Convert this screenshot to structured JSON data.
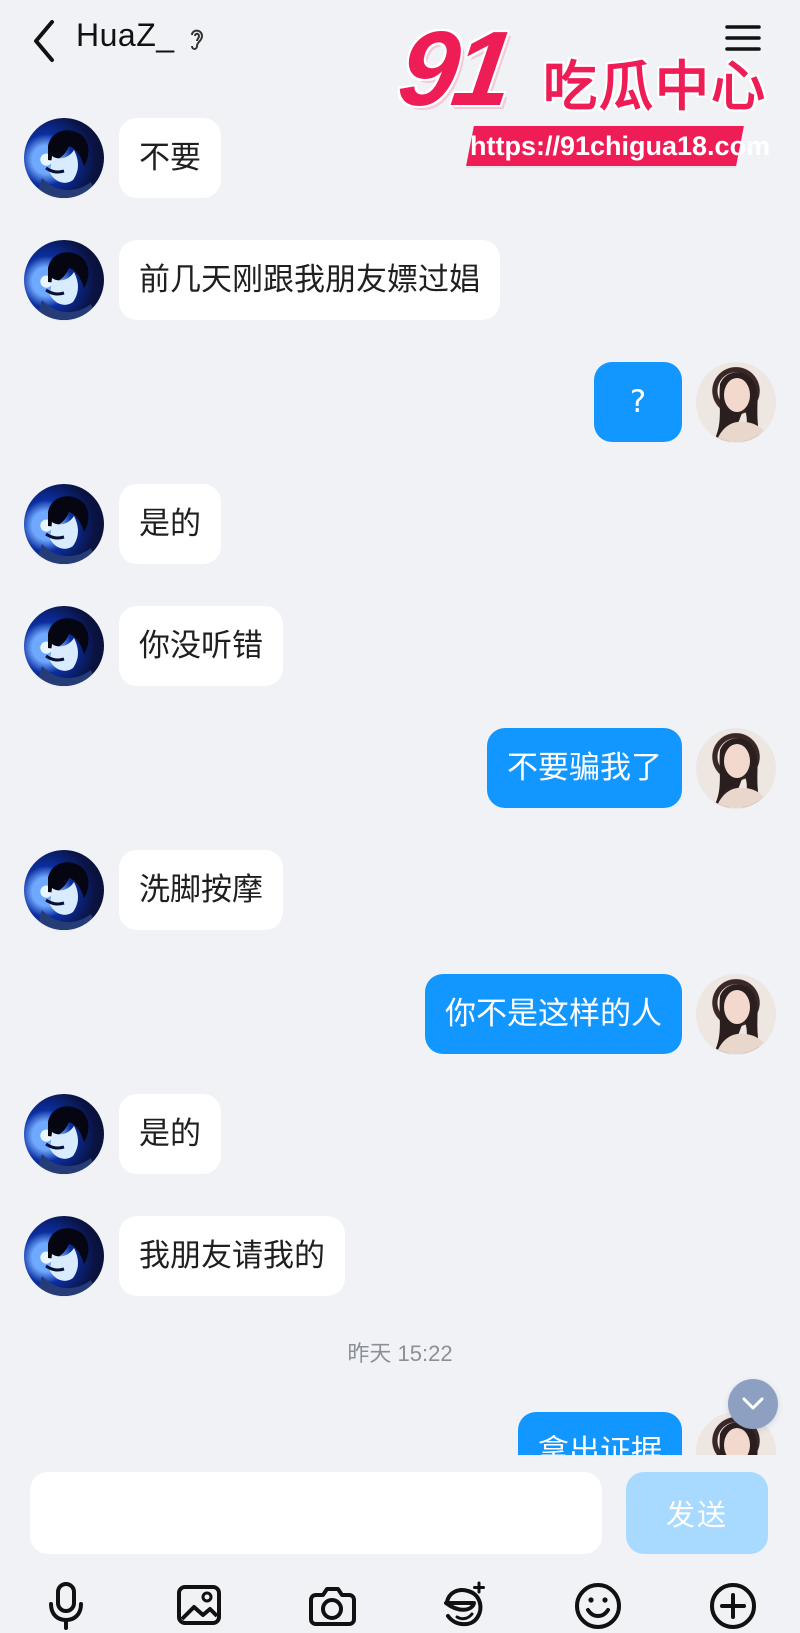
{
  "header": {
    "title": "HuaZ_",
    "back_icon": "chevron-left-icon",
    "audio_icon": "ear-icon",
    "menu_icon": "menu-icon"
  },
  "watermark": {
    "number": "91",
    "text": "吃瓜中心",
    "url": "https://91chigua18.com"
  },
  "messages": [
    {
      "side": "left",
      "text": "不要"
    },
    {
      "side": "left",
      "text": "前几天刚跟我朋友嫖过娼"
    },
    {
      "side": "right",
      "text": "?"
    },
    {
      "side": "left",
      "text": "是的"
    },
    {
      "side": "left",
      "text": "你没听错"
    },
    {
      "side": "right",
      "text": "不要骗我了"
    },
    {
      "side": "left",
      "text": "洗脚按摩"
    },
    {
      "side": "right",
      "text": "你不是这样的人"
    },
    {
      "side": "left",
      "text": "是的"
    },
    {
      "side": "left",
      "text": "我朋友请我的"
    },
    {
      "side": "right",
      "text": "拿出证据"
    }
  ],
  "timestamp": "昨天 15:22",
  "composer": {
    "placeholder": "",
    "send_label": "发送"
  },
  "toolbar": {
    "icons": [
      "microphone-icon",
      "image-icon",
      "camera-icon",
      "emoji-sticker-icon",
      "smile-icon",
      "plus-icon"
    ]
  },
  "colors": {
    "background": "#f1f2f6",
    "incoming_bubble": "#ffffff",
    "outgoing_bubble": "#1296ff",
    "send_button": "#a8daff",
    "watermark": "#ef1d56"
  }
}
